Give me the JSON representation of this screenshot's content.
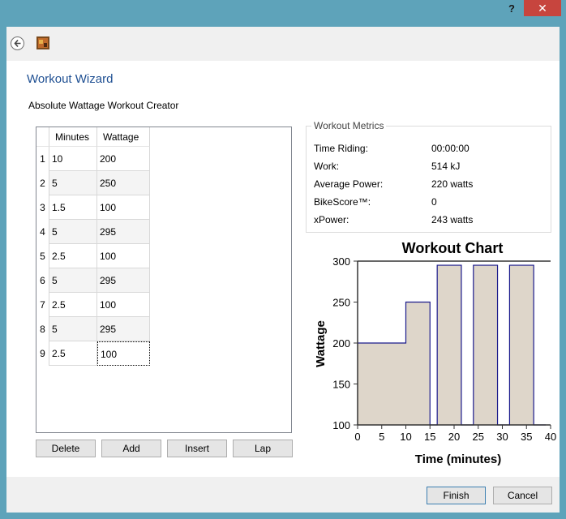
{
  "window": {
    "help_label": "?",
    "close_label": "✕"
  },
  "wizard": {
    "title": "Workout Wizard",
    "subtitle": "Absolute Wattage Workout Creator"
  },
  "table": {
    "columns": [
      "Minutes",
      "Wattage"
    ],
    "rows": [
      {
        "num": "1",
        "minutes": "10",
        "wattage": "200"
      },
      {
        "num": "2",
        "minutes": "5",
        "wattage": "250"
      },
      {
        "num": "3",
        "minutes": "1.5",
        "wattage": "100"
      },
      {
        "num": "4",
        "minutes": "5",
        "wattage": "295"
      },
      {
        "num": "5",
        "minutes": "2.5",
        "wattage": "100"
      },
      {
        "num": "6",
        "minutes": "5",
        "wattage": "295"
      },
      {
        "num": "7",
        "minutes": "2.5",
        "wattage": "100"
      },
      {
        "num": "8",
        "minutes": "5",
        "wattage": "295"
      },
      {
        "num": "9",
        "minutes": "2.5",
        "wattage": "100"
      }
    ]
  },
  "buttons": {
    "delete": "Delete",
    "add": "Add",
    "insert": "Insert",
    "lap": "Lap",
    "finish": "Finish",
    "cancel": "Cancel"
  },
  "metrics": {
    "legend": "Workout Metrics",
    "items": [
      {
        "label": "Time Riding:",
        "value": "00:00:00"
      },
      {
        "label": "Work:",
        "value": "514 kJ"
      },
      {
        "label": "Average Power:",
        "value": "220 watts"
      },
      {
        "label": "BikeScore™:",
        "value": "0"
      },
      {
        "label": "xPower:",
        "value": "243 watts"
      }
    ]
  },
  "colors": {
    "chart_fill": "#ded6ca",
    "chart_line": "#1a1a8c",
    "title_text": "#1e4f92"
  },
  "chart_data": {
    "type": "area",
    "title": "Workout Chart",
    "xlabel": "Time (minutes)",
    "ylabel": "Wattage",
    "xlim": [
      0,
      40
    ],
    "ylim": [
      100,
      300
    ],
    "xticks": [
      0,
      5,
      10,
      15,
      20,
      25,
      30,
      35,
      40
    ],
    "yticks": [
      100,
      150,
      200,
      250,
      300
    ],
    "grid": false,
    "segments": [
      {
        "start": 0,
        "end": 10,
        "watts": 200
      },
      {
        "start": 10,
        "end": 15,
        "watts": 250
      },
      {
        "start": 15,
        "end": 16.5,
        "watts": 100
      },
      {
        "start": 16.5,
        "end": 21.5,
        "watts": 295
      },
      {
        "start": 21.5,
        "end": 24,
        "watts": 100
      },
      {
        "start": 24,
        "end": 29,
        "watts": 295
      },
      {
        "start": 29,
        "end": 31.5,
        "watts": 100
      },
      {
        "start": 31.5,
        "end": 36.5,
        "watts": 295
      },
      {
        "start": 36.5,
        "end": 39,
        "watts": 100
      }
    ]
  }
}
